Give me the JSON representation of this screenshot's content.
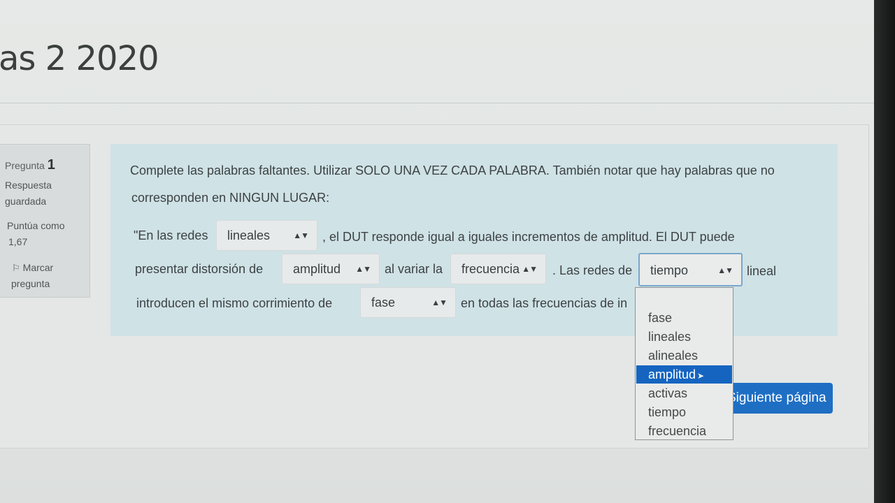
{
  "page": {
    "title": "as 2 2020"
  },
  "info": {
    "question_label": "Pregunta",
    "question_number": "1",
    "state_line1": "Respuesta",
    "state_line2": "guardada",
    "grade_line1": "Puntúa como",
    "grade_line2": "1,67",
    "flag_line1": "Marcar",
    "flag_line2": "pregunta",
    "flag_icon": "flag-icon"
  },
  "question": {
    "instructions_line1": "Complete las palabras faltantes. Utilizar SOLO UNA VEZ CADA PALABRA. También notar que hay palabras que no",
    "instructions_line2": "corresponden en NINGUN LUGAR:",
    "line1_part1": "\"En las redes",
    "line1_part2": ", el DUT responde igual a iguales incrementos de amplitud. El DUT puede",
    "line2_part1": "presentar distorsión de",
    "line2_part2": "al variar la",
    "line2_part3": ". Las redes de",
    "line2_part4": "lineal",
    "line3_part1": "introducen el mismo corrimiento de",
    "line3_part2": "en todas las frecuencias de in"
  },
  "selects": {
    "s1": "lineales",
    "s2": "amplitud",
    "s3": "frecuencia",
    "s4": "tiempo",
    "s5": "fase",
    "caret": "▲▼"
  },
  "dropdown": {
    "options": [
      "fase",
      "lineales",
      "alineales",
      "amplitud",
      "activas",
      "tiempo",
      "frecuencia"
    ],
    "highlighted": "amplitud"
  },
  "next_button": {
    "label": "Siguiente página"
  }
}
